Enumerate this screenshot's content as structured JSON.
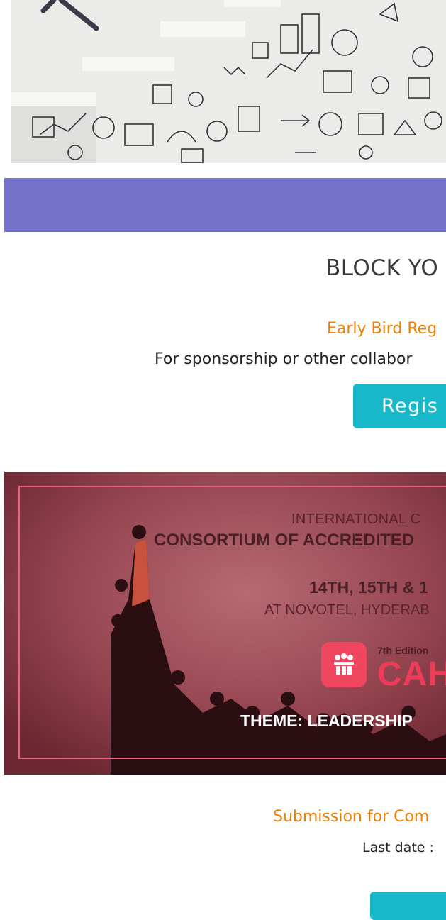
{
  "colors": {
    "band": "#7572c9",
    "accent_orange": "#f07d00",
    "button_teal": "#17b8c9",
    "banner_bg": "#9a4b55",
    "banner_border": "#e8647a"
  },
  "hero": {
    "icon": "sketch-business-icons-image"
  },
  "block": {
    "heading": "BLOCK YO",
    "early_bird": "Early Bird Reg",
    "sponsorship": "For sponsorship or other collabor",
    "register_label": "Regis"
  },
  "banner": {
    "line1": "INTERNATIONAL C",
    "line2": "CONSORTIUM OF ACCREDITED",
    "line3": "14TH, 15TH & 1",
    "line4": "AT NOVOTEL, HYDERAB",
    "edition": "7th Edition",
    "brand": "CAH",
    "theme": "THEME: LEADERSHIP",
    "logo_icon": "people-group-icon"
  },
  "submission": {
    "title": "Submission for Com",
    "last_date": "Last date :"
  }
}
